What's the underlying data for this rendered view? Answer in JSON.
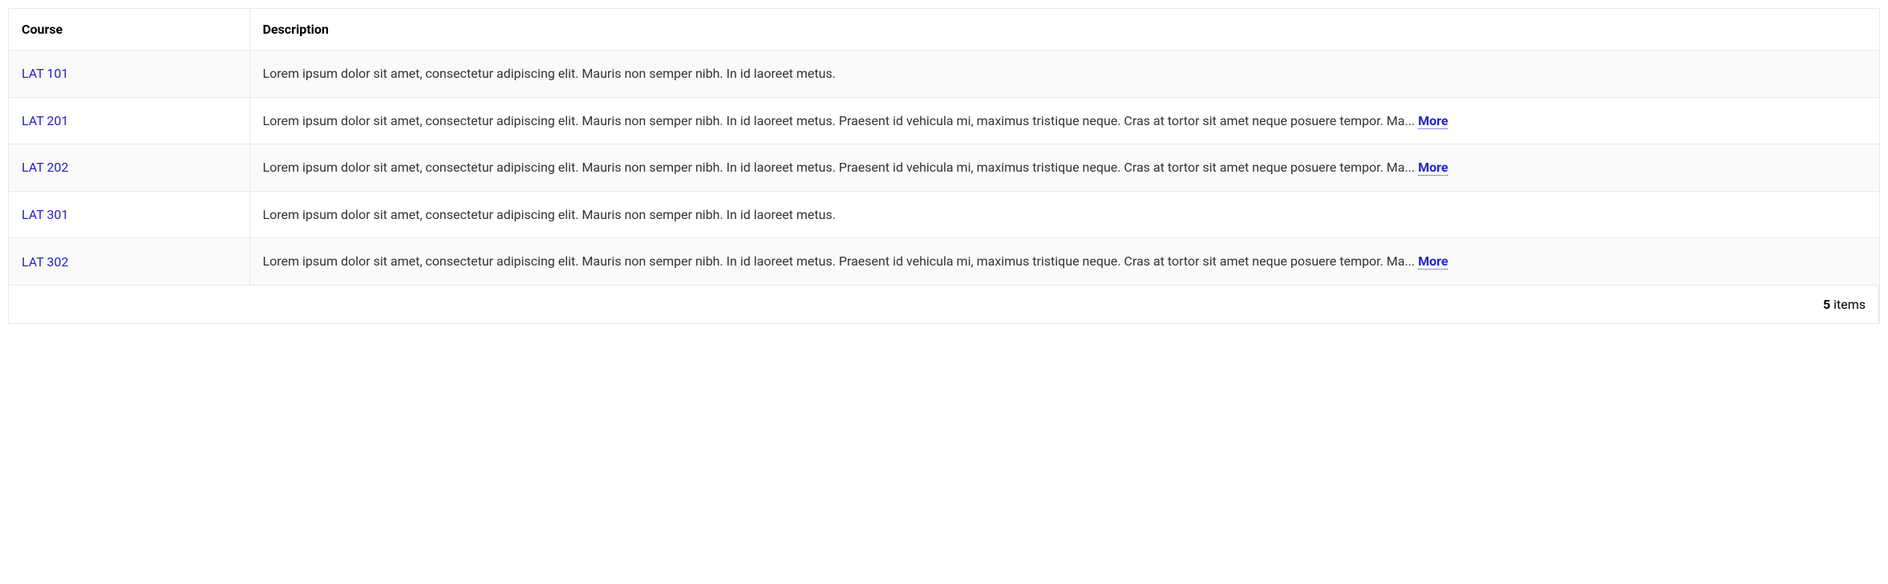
{
  "headers": {
    "course": "Course",
    "description": "Description"
  },
  "rows": [
    {
      "course": "LAT 101",
      "description": "Lorem ipsum dolor sit amet, consectetur adipiscing elit. Mauris non semper nibh. In id laoreet metus.",
      "hasMore": false
    },
    {
      "course": "LAT 201",
      "description": "Lorem ipsum dolor sit amet, consectetur adipiscing elit. Mauris non semper nibh. In id laoreet metus. Praesent id vehicula mi, maximus tristique neque. Cras at tortor sit amet neque posuere tempor. Ma... ",
      "hasMore": true
    },
    {
      "course": "LAT 202",
      "description": "Lorem ipsum dolor sit amet, consectetur adipiscing elit. Mauris non semper nibh. In id laoreet metus. Praesent id vehicula mi, maximus tristique neque. Cras at tortor sit amet neque posuere tempor. Ma... ",
      "hasMore": true
    },
    {
      "course": "LAT 301",
      "description": "Lorem ipsum dolor sit amet, consectetur adipiscing elit. Mauris non semper nibh. In id laoreet metus.",
      "hasMore": false
    },
    {
      "course": "LAT 302",
      "description": "Lorem ipsum dolor sit amet, consectetur adipiscing elit. Mauris non semper nibh. In id laoreet metus. Praesent id vehicula mi, maximus tristique neque. Cras at tortor sit amet neque posuere tempor. Ma... ",
      "hasMore": true
    }
  ],
  "moreLabel": "More",
  "footer": {
    "count": "5",
    "itemsLabel": " items"
  }
}
